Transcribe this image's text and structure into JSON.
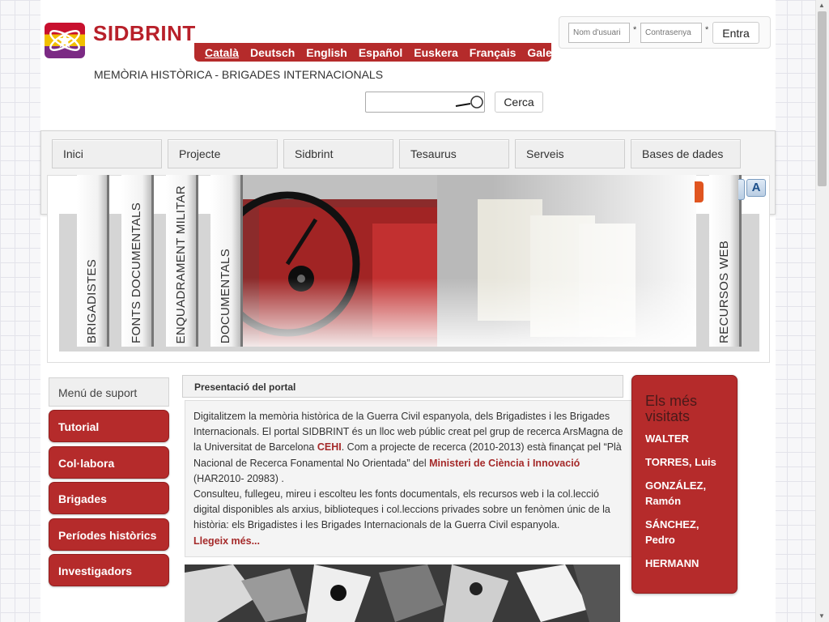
{
  "site": {
    "title": "SIDBRINT",
    "subtitle": "MEMÒRIA HISTÒRICA - BRIGADES INTERNACIONALS"
  },
  "languages": [
    {
      "label": "Català",
      "active": true
    },
    {
      "label": "Deutsch",
      "active": false
    },
    {
      "label": "English",
      "active": false
    },
    {
      "label": "Español",
      "active": false
    },
    {
      "label": "Euskera",
      "active": false
    },
    {
      "label": "Français",
      "active": false
    },
    {
      "label": "Galego",
      "active": false
    }
  ],
  "login": {
    "username_placeholder": "Nom d'usuari",
    "password_placeholder": "Contrasenya",
    "required_mark": "*",
    "submit_label": "Entra"
  },
  "search": {
    "value": "",
    "button_label": "Cerca"
  },
  "nav": {
    "tabs": [
      "Inici",
      "Projecte",
      "Sidbrint",
      "Tesaurus",
      "Serveis",
      "Bases de dades"
    ]
  },
  "banner": {
    "vertical_tabs": [
      "BRIGADISTES",
      "FONTS DOCUMENTALS",
      "ENQUADRAMENT MILITAR",
      "DOCUMENTALS",
      "RECURSOS WEB"
    ],
    "font_size_button": "A"
  },
  "support_menu": {
    "header": "Menú de suport",
    "items": [
      "Tutorial",
      "Col·labora",
      "Brigades",
      "Períodes històrics",
      "Investigadors"
    ]
  },
  "presentation": {
    "header": "Presentació del portal",
    "p1_a": "Digitalitzem la memòria històrica de la Guerra Civil espanyola, dels Brigadistes i les Brigades Internacionals. El portal SIDBRINT és un lloc web públic creat pel grup de recerca ArsMagna de la Universitat de Barcelona ",
    "link_cehi": "CEHI",
    "p1_b": ". Com a projecte de recerca (2010-2013) està finançat pel “Plà Nacional de Recerca Fonamental No Orientada” del ",
    "link_ministeri": "Ministeri de Ciència i Innovació",
    "p1_c": " (HAR2010- 20983) .",
    "p2": "Consulteu, fullegeu, mireu i escolteu les fonts documentals, els recursos web i la col.lecció digital disponibles als arxius, biblioteques i col.leccions privades sobre un fenòmen únic de la història: els Brigadistes i les Brigades Internacionals de la Guerra Civil espanyola.",
    "read_more": "Llegeix més..."
  },
  "most_visited": {
    "title": "Els més visitats",
    "items": [
      "WALTER",
      "TORRES, Luis",
      "GONZÁLEZ,\nRamón",
      "SÁNCHEZ,\nPedro",
      "HERMANN"
    ]
  },
  "colors": {
    "brand_red": "#b52b2b",
    "title_red": "#b8202a",
    "link_red": "#a52a2a"
  }
}
